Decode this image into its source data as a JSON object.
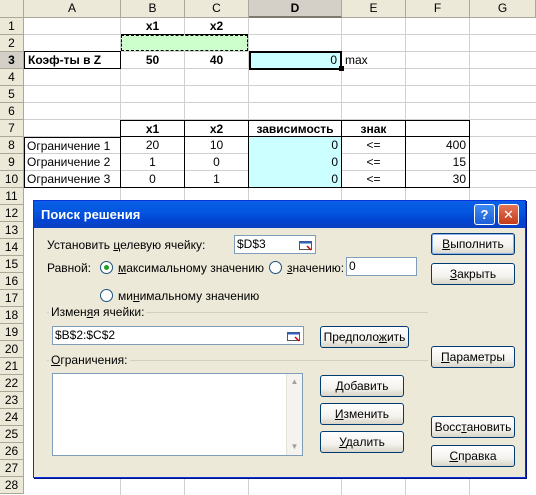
{
  "sheet": {
    "columns": [
      "A",
      "B",
      "C",
      "D",
      "E",
      "F",
      "G"
    ],
    "active_column": "D",
    "rows": [
      "1",
      "2",
      "3",
      "4",
      "5",
      "6",
      "7",
      "8",
      "9",
      "10",
      "11",
      "12",
      "13",
      "14",
      "15",
      "16",
      "17",
      "18",
      "19",
      "20",
      "21",
      "22",
      "23",
      "24",
      "25",
      "26",
      "27",
      "28"
    ],
    "active_row": "3",
    "header_row1": {
      "b": "x1",
      "c": "x2"
    },
    "row3": {
      "a": "Коэф-ты в Z",
      "b": "50",
      "c": "40",
      "d": "0",
      "e": "max"
    },
    "row7": {
      "b": "x1",
      "c": "x2",
      "d": "зависимость",
      "e": "знак"
    },
    "constraints": [
      {
        "name": "Ограничение 1",
        "x1": "20",
        "x2": "10",
        "dep": "0",
        "sign": "<=",
        "rhs": "400"
      },
      {
        "name": "Ограничение 2",
        "x1": "1",
        "x2": "0",
        "dep": "0",
        "sign": "<=",
        "rhs": "15"
      },
      {
        "name": "Ограничение 3",
        "x1": "0",
        "x2": "1",
        "dep": "0",
        "sign": "<=",
        "rhs": "30"
      }
    ]
  },
  "dialog": {
    "title": "Поиск решения",
    "help_glyph": "?",
    "close_glyph": "✕",
    "target_label_pre": "Установить ",
    "target_label_u": "ц",
    "target_label_post": "елевую ячейку:",
    "target_value": "$D$3",
    "equal_label": "Равной:",
    "opt_max_pre": "",
    "opt_max_u": "м",
    "opt_max_post": "аксимальному значению",
    "opt_value_pre": "",
    "opt_value_u": "з",
    "opt_value_post": "начению:",
    "value_field": "0",
    "opt_min_pre": "ми",
    "opt_min_u": "н",
    "opt_min_post": "имальному значению",
    "changing_pre": "Измен",
    "changing_u": "я",
    "changing_post": "я ячейки:",
    "changing_value": "$B$2:$C$2",
    "guess_pre": "Предполо",
    "guess_u": "ж",
    "guess_post": "ить",
    "constraints_pre": "",
    "constraints_u": "О",
    "constraints_post": "граничения:",
    "buttons": {
      "run_pre": "",
      "run_u": "В",
      "run_post": "ыполнить",
      "close_pre": "",
      "close_u": "З",
      "close_post": "акрыть",
      "params_pre": "",
      "params_u": "П",
      "params_post": "араметры",
      "add_pre": "",
      "add_u": "Д",
      "add_post": "обавить",
      "change_pre": "",
      "change_u": "И",
      "change_post": "зменить",
      "delete_pre": "",
      "delete_u": "У",
      "delete_post": "далить",
      "restore_pre": "Восс",
      "restore_u": "т",
      "restore_post": "ановить",
      "help_pre": "",
      "help_u": "С",
      "help_post": "правка"
    },
    "selected_option": "max"
  },
  "colors": {
    "accent": "#0a5fe6",
    "cyan_cell": "#ccffff",
    "green_cell": "#ccffcc"
  }
}
